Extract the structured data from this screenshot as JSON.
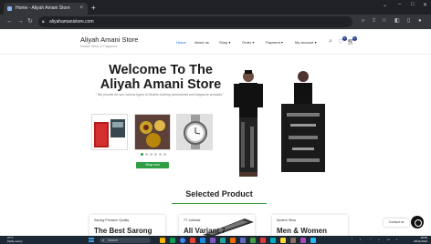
{
  "browser": {
    "tab_title": "Home - Aliyah Amani Store",
    "tab_close": "×",
    "new_tab": "+",
    "url": "aliyahamanistore.com"
  },
  "site": {
    "brand_title": "Aliyah Amani Store",
    "brand_subtitle": "Muslim Wear & Fragrance",
    "menu": [
      "Home",
      "About us",
      "Shop ▾",
      "Order ▾",
      "Payment ▾",
      "My account ▾"
    ],
    "cart_count": "0",
    "wishlist_count": "0"
  },
  "hero": {
    "title_line1": "Welcome To The",
    "title_line2": "Aliyah Amani Store",
    "subtitle": "\" We provide for you various types of Muslim clothing accessories and fragrance products \"",
    "shop_button": "Shop now"
  },
  "section": {
    "title": "Selected Product"
  },
  "cards": [
    {
      "category": "Sarung Premium Quality",
      "name": "The Best Sarong"
    },
    {
      "category": "TT Jubbahs",
      "name": "All Variant 7"
    },
    {
      "category": "Modern Wear",
      "name": "Men & Women"
    }
  ],
  "contact": {
    "label": "Contact us"
  },
  "taskbar": {
    "weather_temp": "27°C",
    "weather_desc": "Partly sunny",
    "search_label": "Search",
    "time": "18:59",
    "date": "09/11/2023"
  },
  "colors": {
    "accent_green": "#2e9e45",
    "link_blue": "#1a73e8",
    "taskbar": "#1c2833"
  }
}
